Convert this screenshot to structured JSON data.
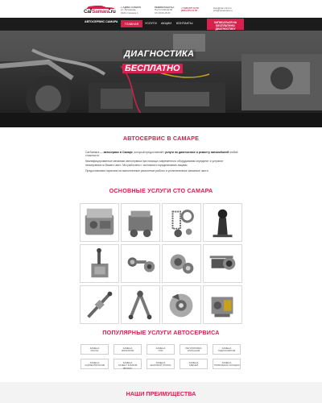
{
  "header": {
    "logo": {
      "prefix": "Car",
      "accent": "Samara",
      "suffix": ".ru"
    },
    "address": {
      "label": "АДРЕС САМАРА",
      "line1": "ул. Литвинова,",
      "line2": "322А строение 1"
    },
    "hours": {
      "label": "РЕЖИМ РАБОТЫ:",
      "line1": "Пн-Пт 9:00-19:00",
      "line2": "Сб 10:00-16:00"
    },
    "phones": {
      "p1": "+7 846 375 41 50",
      "p2": "(846) 375-41-50"
    },
    "emails": {
      "e1": "zkps@car-mtrst.ru",
      "e2": "info@carsamara.ru"
    }
  },
  "nav": {
    "title": "АВТОСЕРВИС САМАРА",
    "items": [
      {
        "label": "ГЛАВНАЯ",
        "active": true
      },
      {
        "label": "УСЛУГИ"
      },
      {
        "label": "АКЦИИ"
      },
      {
        "label": "КОНТАКТЫ"
      }
    ],
    "cta": "ЗАПИСАТЬСЯ НА БЕСПЛАТНУЮ ДИАГНОСТИКУ"
  },
  "hero": {
    "line1": "ДИАГНОСТИКА",
    "line2": "БЕСПЛАТНО"
  },
  "about": {
    "title": "АВТОСЕРВИС В САМАРЕ",
    "p1_a": "CarSamara — ",
    "p1_b": "автосервис в Самаре",
    "p1_c": ", который предоставляет ",
    "p1_d": "услуги по диагностике и ремонту автомобилей",
    "p1_e": " любой сложности.",
    "p2": "Квалифицированные механики автосервиса при помощи современного оборудования определят и устранят неисправности Вашего авто. Мы работаем с частными и юридическими лицами.",
    "p3": "Предоставляем гарантию на выполненные ремонтные работы и установленные запасные части."
  },
  "services": {
    "title": "ОСНОВНЫЕ УСЛУГИ СТО САМАРА",
    "items": [
      "engine-bay",
      "engine-block",
      "springs",
      "gear-shift",
      "gearbox",
      "steering-parts",
      "clutch",
      "wiper-motor",
      "rack",
      "suspension-arm",
      "brake-disc",
      "hvac-unit"
    ]
  },
  "popular": {
    "title": "ПОПУЛЯРНЫЕ УСЛУГИ АВТОСЕРВИСА",
    "buttons": [
      [
        "ЗАМЕНА",
        "МАСЛА"
      ],
      [
        "ЗАМЕНА",
        "ФИЛЬТРОВ"
      ],
      [
        "ЗАМЕНА",
        "ГРМ"
      ],
      [
        "РЕГУЛИРОВКА",
        "КЛАПАНОВ"
      ],
      [
        "ЗАМЕНА",
        "ГИДРОКОМПОВ"
      ],
      [
        "ЗАМЕНА",
        "САЙЛЕНТБЛОКОВ"
      ],
      [
        "ЗАМЕНА",
        "САЛЕНТ БЛОКОВ ВТУЛОК"
      ],
      [
        "ЗАМЕНА",
        "ШАРОВОЙ ОПОРЫ"
      ],
      [
        "ЗАМЕНА",
        "СВЕЧЕЙ"
      ],
      [
        "ЗАМЕНА",
        "ТОРМОЗНЫХ КОЛОДОК"
      ]
    ]
  },
  "advantages": {
    "title": "НАШИ ПРЕИМУЩЕСТВА"
  },
  "colors": {
    "accent": "#d6204e",
    "dark": "#1a1a1a"
  }
}
